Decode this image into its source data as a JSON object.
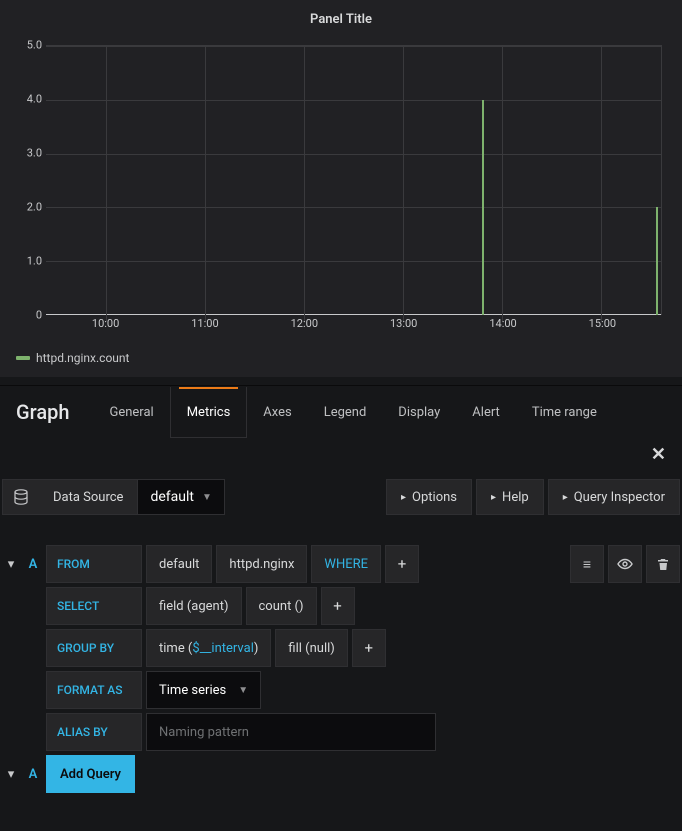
{
  "panel": {
    "title": "Panel Title"
  },
  "graph_title": "Graph",
  "tabs": [
    "General",
    "Metrics",
    "Axes",
    "Legend",
    "Display",
    "Alert",
    "Time range"
  ],
  "active_tab_index": 1,
  "legend": {
    "series": "httpd.nginx.count",
    "color": "#7eb26d"
  },
  "chart_data": {
    "type": "bar",
    "y_ticks": [
      0,
      1.0,
      2.0,
      3.0,
      4.0,
      5.0
    ],
    "x_ticks": [
      "10:00",
      "11:00",
      "12:00",
      "13:00",
      "14:00",
      "15:00"
    ],
    "ylim": [
      0,
      5
    ],
    "xmin_hour": 9.4,
    "xmax_hour": 15.6,
    "series": [
      {
        "name": "httpd.nginx.count",
        "points": [
          {
            "x_hour": 13.8,
            "y": 4.0
          },
          {
            "x_hour": 15.55,
            "y": 2.0
          }
        ]
      }
    ]
  },
  "datasource": {
    "label": "Data Source",
    "selected": "default",
    "options_btn": "Options",
    "help_btn": "Help",
    "inspector_btn": "Query Inspector"
  },
  "query": {
    "letter": "A",
    "from_label": "FROM",
    "from_rp": "default",
    "from_measurement": "httpd.nginx",
    "where_label": "WHERE",
    "select_label": "SELECT",
    "select_field": "field (agent)",
    "select_agg": "count ()",
    "groupby_label": "GROUP BY",
    "groupby_time_prefix": "time (",
    "groupby_time_var": "$__interval",
    "groupby_time_suffix": ")",
    "groupby_fill": "fill (null)",
    "format_label": "FORMAT AS",
    "format_value": "Time series",
    "alias_label": "ALIAS BY",
    "alias_placeholder": "Naming pattern",
    "add_query": "Add Query"
  }
}
